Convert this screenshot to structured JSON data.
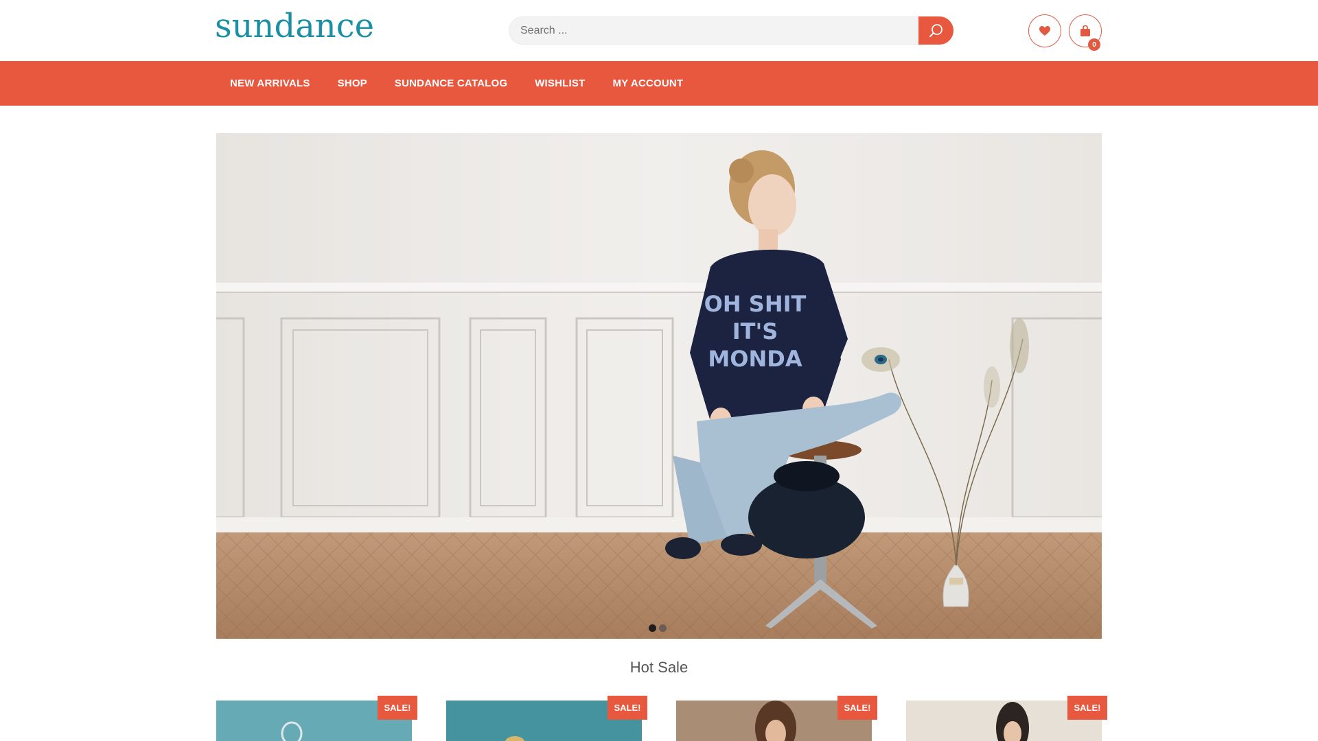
{
  "brand": {
    "logo_text": "sundance",
    "logo_color": "#1b8fa3",
    "accent_color": "#e8583f"
  },
  "search": {
    "placeholder": "Search ...",
    "value": "",
    "button_icon": "search-icon"
  },
  "header_icons": {
    "wishlist_icon": "heart-icon",
    "cart_icon": "shopping-bag-icon",
    "cart_count": "0"
  },
  "nav": {
    "items": [
      {
        "label": "NEW ARRIVALS"
      },
      {
        "label": "SHOP"
      },
      {
        "label": "SUNDANCE CATALOG"
      },
      {
        "label": "WISHLIST"
      },
      {
        "label": "MY ACCOUNT"
      }
    ]
  },
  "hero": {
    "sweater_text_line1": "OH SHIT",
    "sweater_text_line2": "IT'S",
    "sweater_text_line3": "MONDA",
    "slides_total": 2,
    "active_slide": 1
  },
  "hot_sale": {
    "title": "Hot Sale",
    "products": [
      {
        "badge": "SALE!"
      },
      {
        "badge": "SALE!"
      },
      {
        "badge": "SALE!"
      },
      {
        "badge": "SALE!"
      }
    ]
  }
}
